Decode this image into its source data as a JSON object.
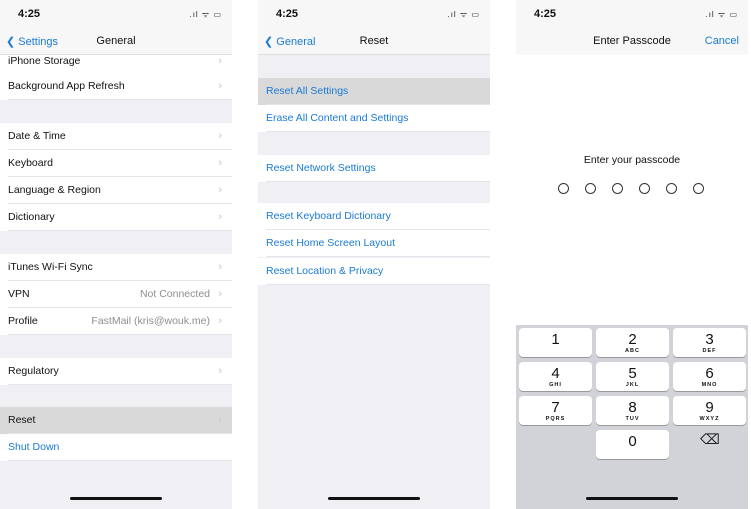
{
  "status": {
    "time": "4:25",
    "icons": "signal-wifi-battery"
  },
  "general": {
    "back": "Settings",
    "title": "General",
    "rows": [
      {
        "label": "iPhone Storage"
      },
      {
        "label": "Background App Refresh"
      },
      {
        "label": "Date & Time"
      },
      {
        "label": "Keyboard"
      },
      {
        "label": "Language & Region"
      },
      {
        "label": "Dictionary"
      },
      {
        "label": "iTunes Wi-Fi Sync"
      },
      {
        "label": "VPN",
        "value": "Not Connected"
      },
      {
        "label": "Profile",
        "value": "FastMail (kris@wouk.me)"
      },
      {
        "label": "Regulatory"
      },
      {
        "label": "Reset"
      },
      {
        "label": "Shut Down"
      }
    ]
  },
  "reset": {
    "back": "General",
    "title": "Reset",
    "rows": [
      {
        "label": "Reset All Settings"
      },
      {
        "label": "Erase All Content and Settings"
      },
      {
        "label": "Reset Network Settings"
      },
      {
        "label": "Reset Keyboard Dictionary"
      },
      {
        "label": "Reset Home Screen Layout"
      },
      {
        "label": "Reset Location & Privacy"
      }
    ]
  },
  "passcode": {
    "title": "Enter Passcode",
    "cancel": "Cancel",
    "prompt": "Enter your passcode",
    "digits_entered": 0,
    "digits_total": 6,
    "keys": [
      {
        "n": "1",
        "l": ""
      },
      {
        "n": "2",
        "l": "ABC"
      },
      {
        "n": "3",
        "l": "DEF"
      },
      {
        "n": "4",
        "l": "GHI"
      },
      {
        "n": "5",
        "l": "JKL"
      },
      {
        "n": "6",
        "l": "MNO"
      },
      {
        "n": "7",
        "l": "PQRS"
      },
      {
        "n": "8",
        "l": "TUV"
      },
      {
        "n": "9",
        "l": "WXYZ"
      },
      {
        "n": "0",
        "l": ""
      }
    ]
  },
  "colors": {
    "accent": "#1a7ad4",
    "highlight": "#d9d9d9"
  }
}
